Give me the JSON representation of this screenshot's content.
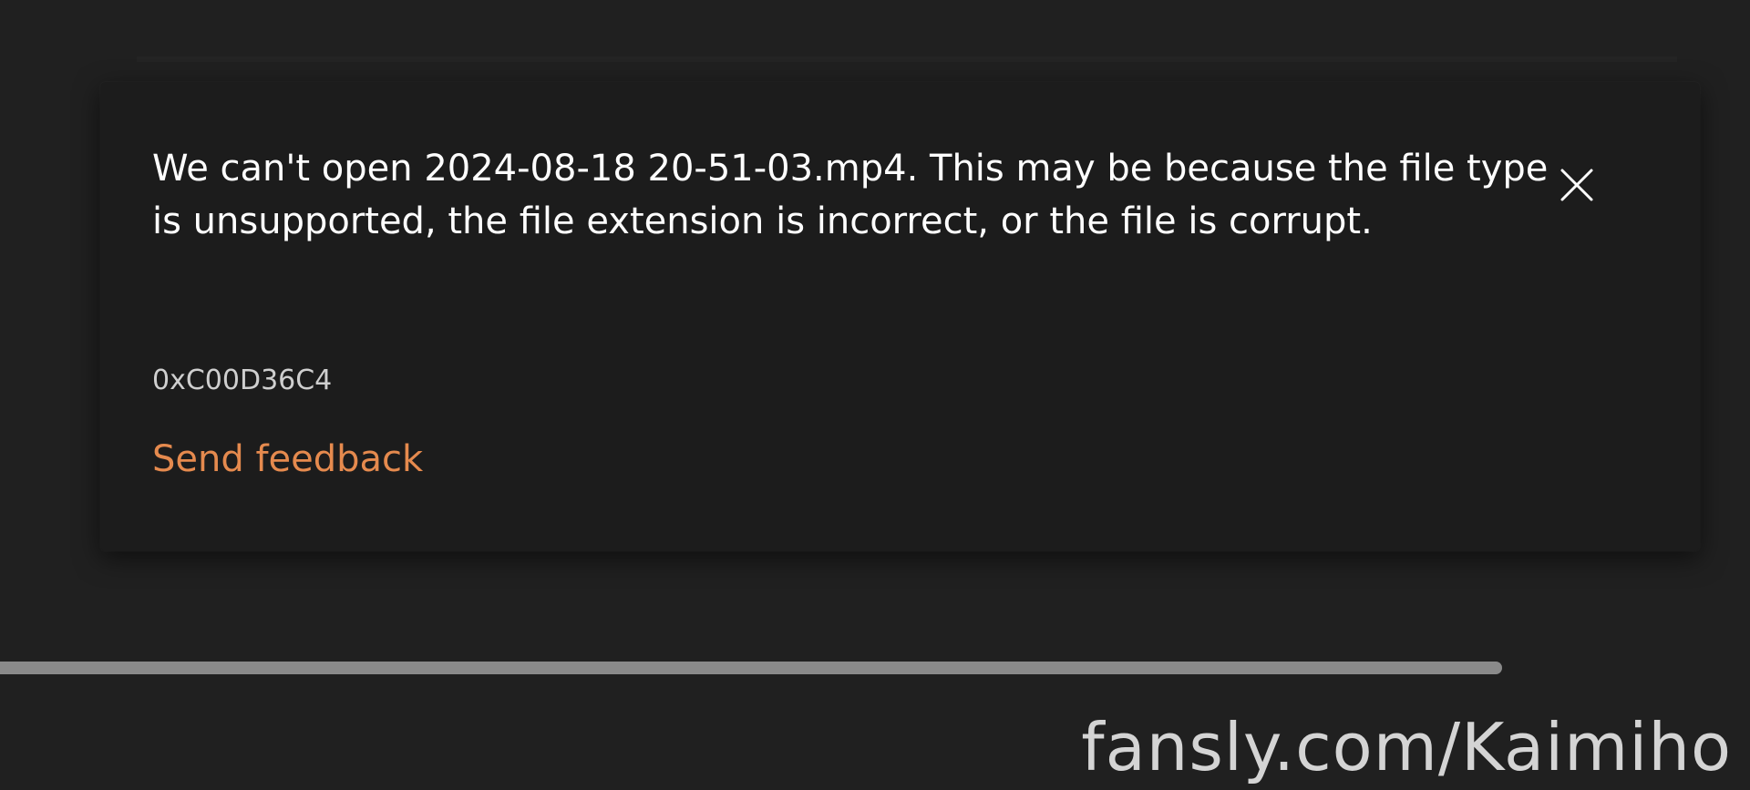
{
  "dialog": {
    "message": "We can't open 2024-08-18 20-51-03.mp4. This may be because the file type is unsupported, the file extension is incorrect, or the file is corrupt.",
    "error_code": "0xC00D36C4",
    "feedback_label": "Send feedback",
    "close_icon": "close-icon"
  },
  "player": {
    "progress": 1.0
  },
  "watermark": {
    "text": "fansly.com/Kaimiho"
  },
  "colors": {
    "background": "#202020",
    "dialog_background": "#1c1c1c",
    "link_accent": "#e58a4e",
    "text_primary": "#ffffff"
  }
}
